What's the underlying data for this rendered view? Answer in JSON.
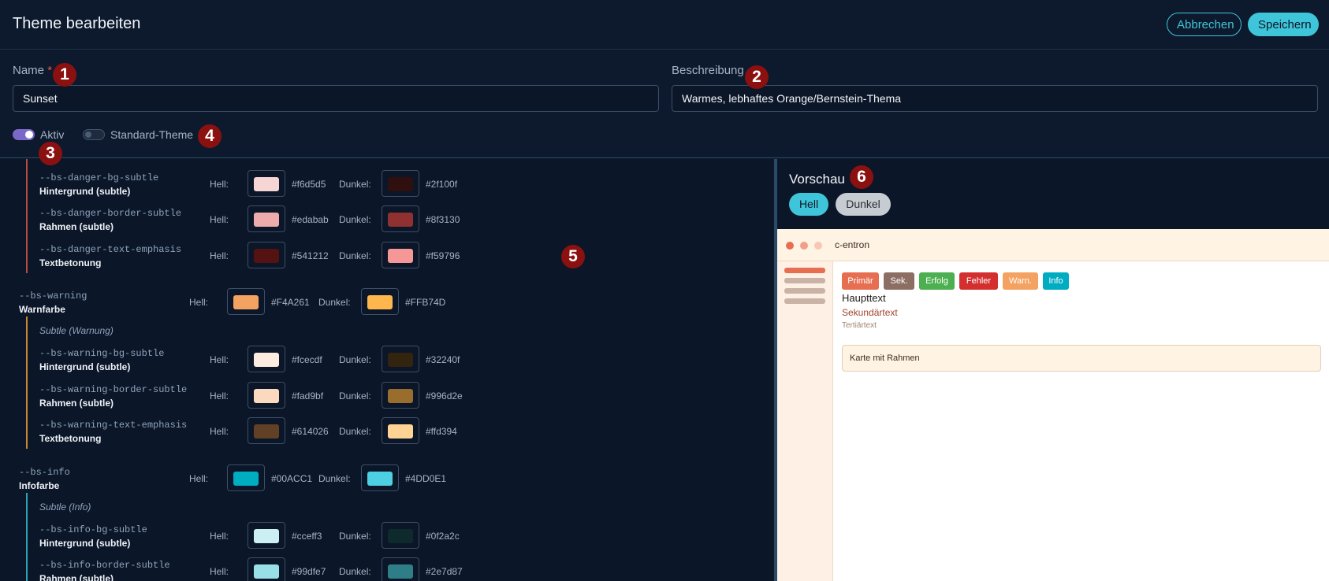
{
  "header": {
    "title": "Theme bearbeiten",
    "cancel_label": "Abbrechen",
    "save_label": "Speichern"
  },
  "form": {
    "name_label": "Name",
    "required_mark": "*",
    "name_value": "Sunset",
    "desc_label": "Beschreibung",
    "desc_value": "Warmes, lebhaftes Orange/Bernstein-Thema",
    "active_label": "Aktiv",
    "active_on": true,
    "default_label": "Standard-Theme",
    "default_on": false
  },
  "badges": [
    "1",
    "2",
    "3",
    "4",
    "5",
    "6"
  ],
  "color_rows": {
    "hell_label": "Hell:",
    "dunkel_label": "Dunkel:",
    "danger": [
      {
        "var": "--bs-danger-bg-subtle",
        "label": "Hintergrund (subtle)",
        "light": "#f6d5d5",
        "dark": "#2f100f"
      },
      {
        "var": "--bs-danger-border-subtle",
        "label": "Rahmen (subtle)",
        "light": "#edabab",
        "dark": "#8f3130"
      },
      {
        "var": "--bs-danger-text-emphasis",
        "label": "Textbetonung",
        "light": "#541212",
        "dark": "#f59796"
      }
    ],
    "warning_main": {
      "var": "--bs-warning",
      "label": "Warnfarbe",
      "light": "#F4A261",
      "dark": "#FFB74D"
    },
    "warning_subtle_heading": "Subtle (Warnung)",
    "warning": [
      {
        "var": "--bs-warning-bg-subtle",
        "label": "Hintergrund (subtle)",
        "light": "#fcecdf",
        "dark": "#32240f"
      },
      {
        "var": "--bs-warning-border-subtle",
        "label": "Rahmen (subtle)",
        "light": "#fad9bf",
        "dark": "#996d2e"
      },
      {
        "var": "--bs-warning-text-emphasis",
        "label": "Textbetonung",
        "light": "#614026",
        "dark": "#ffd394"
      }
    ],
    "info_main": {
      "var": "--bs-info",
      "label": "Infofarbe",
      "light": "#00ACC1",
      "dark": "#4DD0E1"
    },
    "info_subtle_heading": "Subtle (Info)",
    "info": [
      {
        "var": "--bs-info-bg-subtle",
        "label": "Hintergrund (subtle)",
        "light": "#cceff3",
        "dark": "#0f2a2c"
      },
      {
        "var": "--bs-info-border-subtle",
        "label": "Rahmen (subtle)",
        "light": "#99dfe7",
        "dark": "#2e7d87"
      }
    ]
  },
  "preview": {
    "title": "Vorschau",
    "mode_light": "Hell",
    "mode_dark": "Dunkel",
    "app_name": "c-entron",
    "chips": [
      {
        "label": "Primär",
        "color": "#e76f51"
      },
      {
        "label": "Sek.",
        "color": "#8d6e63"
      },
      {
        "label": "Erfolg",
        "color": "#4caf50"
      },
      {
        "label": "Fehler",
        "color": "#d32f2f"
      },
      {
        "label": "Warn.",
        "color": "#f4a261"
      },
      {
        "label": "Info",
        "color": "#00acc1"
      }
    ],
    "main_text": "Haupttext",
    "secondary_text": "Sekundärtext",
    "tertiary_text": "Tertiärtext",
    "card_text": "Karte mit Rahmen"
  },
  "colors": {
    "accent": "#3fc5d9",
    "badge": "#8b1010",
    "danger_line": "#b84a3f",
    "warning_line": "#c98a2c",
    "info_line": "#2aa6b8"
  }
}
